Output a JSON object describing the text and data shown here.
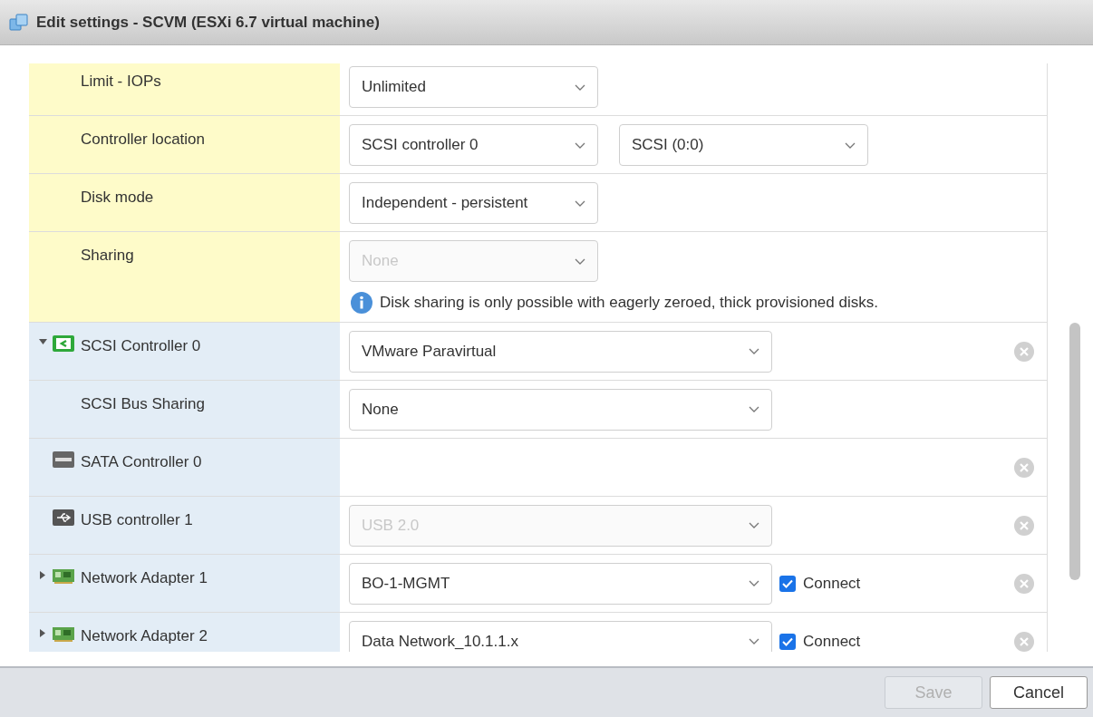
{
  "window": {
    "title": "Edit settings - SCVM (ESXi 6.7 virtual machine)"
  },
  "rows": [
    {
      "kind": "disk",
      "label": "Limit - IOPs",
      "selects": [
        {
          "value": "Unlimited",
          "disabled": false
        }
      ]
    },
    {
      "kind": "disk",
      "label": "Controller location",
      "selects": [
        {
          "value": "SCSI controller 0",
          "disabled": false
        },
        {
          "value": "SCSI (0:0)",
          "disabled": false
        }
      ]
    },
    {
      "kind": "disk",
      "label": "Disk mode",
      "selects": [
        {
          "value": "Independent - persistent",
          "disabled": false
        }
      ]
    },
    {
      "kind": "disk",
      "label": "Sharing",
      "selects": [
        {
          "value": "None",
          "disabled": true
        }
      ],
      "note": "Disk sharing is only possible with eagerly zeroed, thick provisioned disks."
    },
    {
      "kind": "scsi",
      "expanded": true,
      "label": "SCSI Controller 0",
      "selects": [
        {
          "value": "VMware Paravirtual",
          "disabled": false
        }
      ],
      "removable": true
    },
    {
      "kind": "option",
      "label": "SCSI Bus Sharing",
      "selects": [
        {
          "value": "None",
          "disabled": false
        }
      ]
    },
    {
      "kind": "sata",
      "label": "SATA Controller 0",
      "removable": true
    },
    {
      "kind": "usb",
      "label": "USB controller 1",
      "selects": [
        {
          "value": "USB 2.0",
          "disabled": true
        }
      ],
      "removable": true
    },
    {
      "kind": "nic",
      "expanded": false,
      "label": "Network Adapter 1",
      "selects": [
        {
          "value": "BO-1-MGMT",
          "disabled": false
        }
      ],
      "connect": {
        "label": "Connect",
        "checked": true
      },
      "removable": true
    },
    {
      "kind": "nic",
      "expanded": false,
      "label": "Network Adapter 2",
      "selects": [
        {
          "value": "Data Network_10.1.1.x",
          "disabled": false
        }
      ],
      "connect": {
        "label": "Connect",
        "checked": true
      },
      "removable": true
    }
  ],
  "buttons": [
    {
      "label": "Save",
      "disabled": true
    },
    {
      "label": "Cancel",
      "disabled": false
    }
  ]
}
